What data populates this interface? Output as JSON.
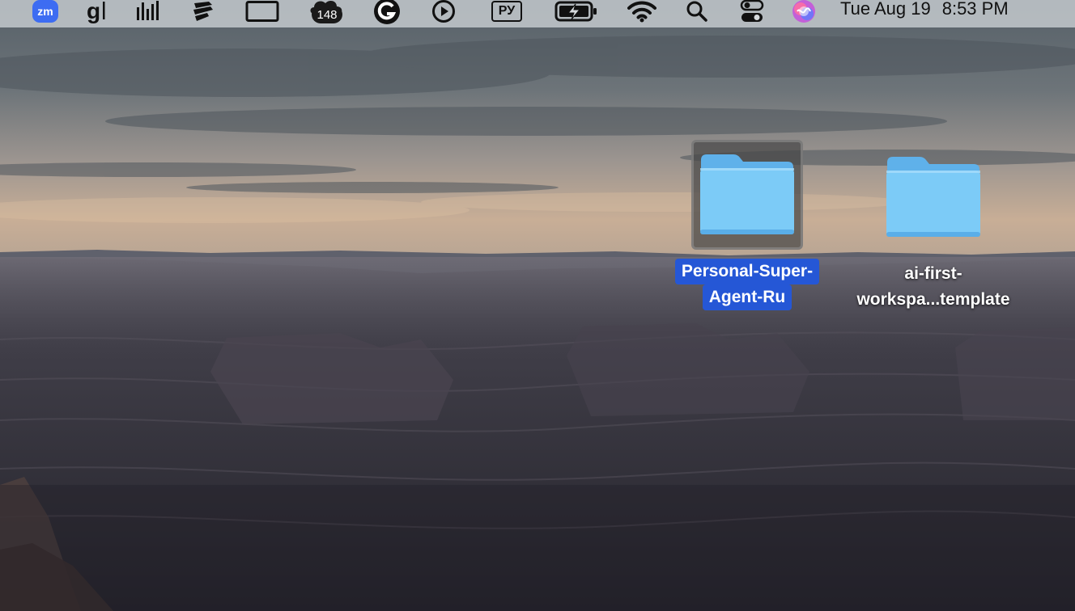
{
  "menubar": {
    "items": [
      {
        "name": "zoom-icon",
        "label": "zm"
      },
      {
        "name": "grammarly-g-icon"
      },
      {
        "name": "audio-levels-icon"
      },
      {
        "name": "notes-app-icon"
      },
      {
        "name": "window-rect-icon"
      },
      {
        "name": "cloud-icon",
        "badge": "148"
      },
      {
        "name": "grammarly-icon"
      },
      {
        "name": "play-circle-icon"
      },
      {
        "name": "input-source-icon",
        "label": "РУ"
      },
      {
        "name": "battery-charging-icon"
      },
      {
        "name": "wifi-icon"
      },
      {
        "name": "spotlight-search-icon"
      },
      {
        "name": "control-center-icon"
      },
      {
        "name": "siri-icon"
      }
    ],
    "clock": {
      "date": "Tue Aug 19",
      "time": "8:53 PM"
    }
  },
  "desktop": {
    "icons": [
      {
        "name": "folder-icon",
        "label_lines": [
          "Personal-Super-",
          "Agent-Ru"
        ],
        "selected": true
      },
      {
        "name": "folder-icon",
        "label_lines": [
          "ai-first-",
          "workspa...template"
        ],
        "selected": false
      }
    ]
  },
  "colors": {
    "folder_blue": "#7ccbf7",
    "folder_tab": "#5fb1ea",
    "selection_blue": "#2557d6",
    "zoom_blue": "#3d6cf2"
  }
}
